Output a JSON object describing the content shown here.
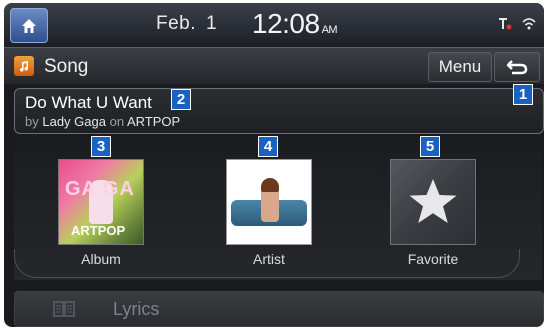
{
  "status_bar": {
    "date_month": "Feb.",
    "date_day": "1",
    "time": "12:08",
    "ampm": "AM"
  },
  "header": {
    "title": "Song",
    "menu_label": "Menu",
    "back_icon": "back-arrow-icon"
  },
  "track": {
    "title": "Do What U Want",
    "by_word": "by",
    "artist": "Lady Gaga",
    "on_word": "on",
    "album": "ARTPOP"
  },
  "tiles": [
    {
      "label": "Album",
      "art_text_1": "GA GA",
      "art_text_2": "ARTPOP",
      "badge": "3"
    },
    {
      "label": "Artist",
      "badge": "4"
    },
    {
      "label": "Favorite",
      "badge": "5"
    }
  ],
  "callouts": {
    "back": "1",
    "title": "2"
  },
  "lyrics": {
    "label": "Lyrics"
  },
  "colors": {
    "accent_blue": "#1a62c2",
    "home_button": "#3d5fa0",
    "song_icon": "#e07a20",
    "background": "#1a1b1e"
  }
}
